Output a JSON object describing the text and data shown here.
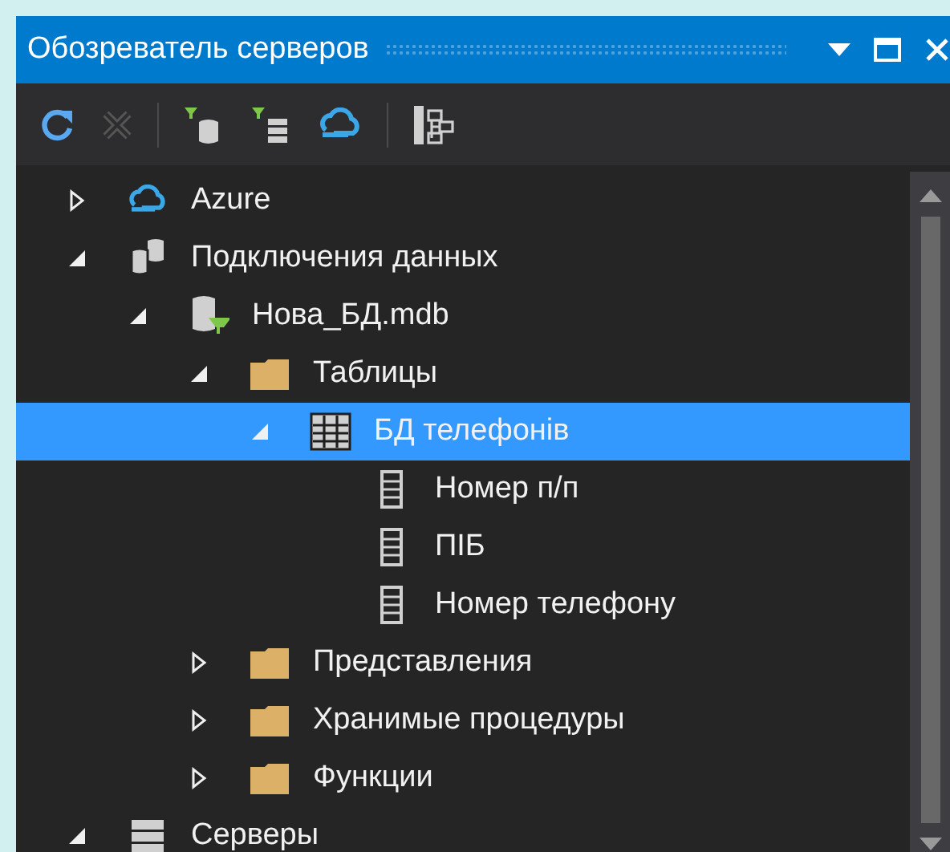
{
  "window": {
    "title": "Обозреватель серверов"
  },
  "toolbar": [
    {
      "kind": "refresh",
      "disabled": false
    },
    {
      "kind": "stop",
      "disabled": true
    },
    {
      "kind": "sep"
    },
    {
      "kind": "filter-db",
      "disabled": false
    },
    {
      "kind": "filter-servers",
      "disabled": false
    },
    {
      "kind": "cloud",
      "disabled": false
    },
    {
      "kind": "sep"
    },
    {
      "kind": "tree",
      "disabled": false
    }
  ],
  "tree": [
    {
      "label": "Azure",
      "kind": "cloud",
      "expanded": false,
      "selected": false
    },
    {
      "label": "Подключения данных",
      "kind": "databases",
      "expanded": true,
      "selected": false,
      "children": [
        {
          "label": "Нова_БД.mdb",
          "kind": "database",
          "expanded": true,
          "selected": false,
          "children": [
            {
              "label": "Таблицы",
              "kind": "folder",
              "expanded": true,
              "selected": false,
              "children": [
                {
                  "label": "БД телефонів",
                  "kind": "table",
                  "expanded": true,
                  "selected": true,
                  "children": [
                    {
                      "label": "Номер п/п",
                      "kind": "column",
                      "selected": false
                    },
                    {
                      "label": "ПІБ",
                      "kind": "column",
                      "selected": false
                    },
                    {
                      "label": "Номер телефону",
                      "kind": "column",
                      "selected": false
                    }
                  ]
                }
              ]
            },
            {
              "label": "Представления",
              "kind": "folder",
              "expanded": false,
              "selected": false
            },
            {
              "label": "Хранимые процедуры",
              "kind": "folder",
              "expanded": false,
              "selected": false
            },
            {
              "label": "Функции",
              "kind": "folder",
              "expanded": false,
              "selected": false
            }
          ]
        }
      ]
    },
    {
      "label": "Серверы",
      "kind": "servers",
      "expanded": true,
      "selected": false
    }
  ]
}
